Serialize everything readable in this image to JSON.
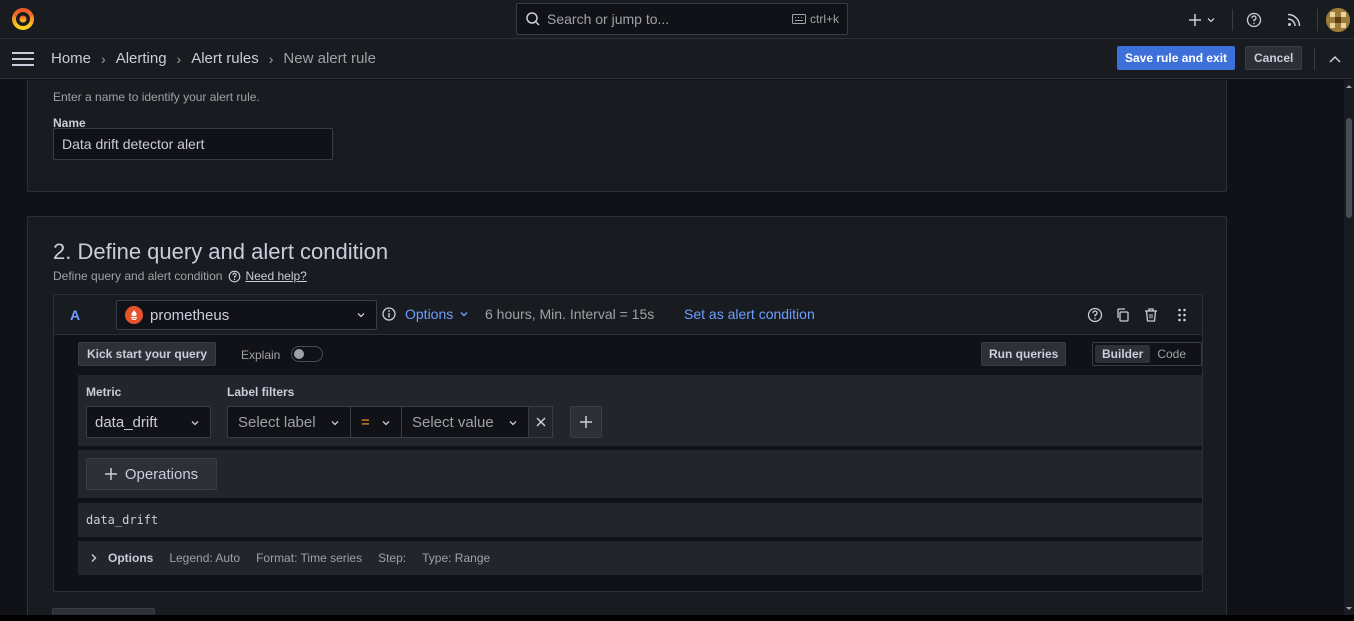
{
  "topbar": {
    "search_placeholder": "Search or jump to...",
    "search_shortcut": "ctrl+k"
  },
  "breadcrumb": {
    "items": [
      "Home",
      "Alerting",
      "Alert rules"
    ],
    "current": "New alert rule"
  },
  "actions": {
    "save_label": "Save rule and exit",
    "cancel_label": "Cancel"
  },
  "section1": {
    "hint": "Enter a name to identify your alert rule.",
    "name_label": "Name",
    "name_value": "Data drift detector alert"
  },
  "section2": {
    "title": "2. Define query and alert condition",
    "subtitle": "Define query and alert condition",
    "help_link": "Need help?"
  },
  "query": {
    "ref_id": "A",
    "datasource": "prometheus",
    "options_label": "Options",
    "options_summary": "6 hours, Min. Interval = 15s",
    "set_condition": "Set as alert condition",
    "kick_start": "Kick start your query",
    "explain_label": "Explain",
    "explain_on": false,
    "run_queries": "Run queries",
    "modes": [
      "Builder",
      "Code"
    ],
    "active_mode": "Builder",
    "metric_label": "Metric",
    "metric_value": "data_drift",
    "label_filters_label": "Label filters",
    "label_placeholder": "Select label",
    "operator": "=",
    "value_placeholder": "Select value",
    "operations_label": "Operations",
    "preview": "data_drift",
    "options_row": {
      "title": "Options",
      "legend": "Legend: Auto",
      "format": "Format: Time series",
      "step": "Step:",
      "type": "Type: Range"
    }
  },
  "colors": {
    "accent": "#6e9fff",
    "primary_button": "#3d71d9",
    "prometheus": "#e6522c",
    "operator": "#ff9830"
  }
}
